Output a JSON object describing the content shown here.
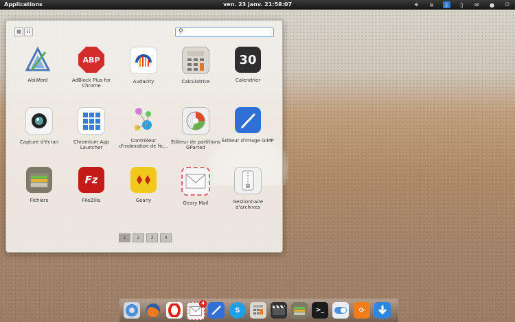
{
  "panel": {
    "applications_label": "Applications",
    "clock": "ven. 23 janv. 21:58:07",
    "tray_icons": [
      "volume-icon",
      "wifi-icon",
      "bluetooth-icon",
      "battery-icon",
      "mail-icon",
      "user-icon",
      "power-icon"
    ]
  },
  "launcher": {
    "search": {
      "value": "",
      "placeholder": ""
    },
    "view_modes": [
      "grid-view",
      "category-view"
    ],
    "apps": [
      {
        "label": "AbiWord"
      },
      {
        "label": "AdBlock Plus for Chrome",
        "icon_text": "ABP"
      },
      {
        "label": "Audacity"
      },
      {
        "label": "Calculatrice"
      },
      {
        "label": "Calendrier",
        "icon_text": "30"
      },
      {
        "label": "Capture d'écran"
      },
      {
        "label": "Chromium App Launcher"
      },
      {
        "label": "Contrôleur d'indexation de fic..."
      },
      {
        "label": "Éditeur de partitions GParted"
      },
      {
        "label": "Éditeur d'image GIMP"
      },
      {
        "label": "Fichiers"
      },
      {
        "label": "FileZilla",
        "icon_text": "Fz"
      },
      {
        "label": "Geany"
      },
      {
        "label": "Geary Mail"
      },
      {
        "label": "Gestionnaire d'archives"
      }
    ],
    "pages": [
      "1",
      "2",
      "3",
      "4"
    ]
  },
  "dock": {
    "items": [
      "chromium",
      "firefox",
      "opera",
      "geary-mail",
      "gimp",
      "skype",
      "calculator",
      "video-editor",
      "files",
      "terminal",
      "switchboard",
      "update-manager",
      "downloader"
    ],
    "badge_count": "4"
  },
  "colors": {
    "panel": "#1f1f1f",
    "search_border": "#7aa6d9"
  }
}
